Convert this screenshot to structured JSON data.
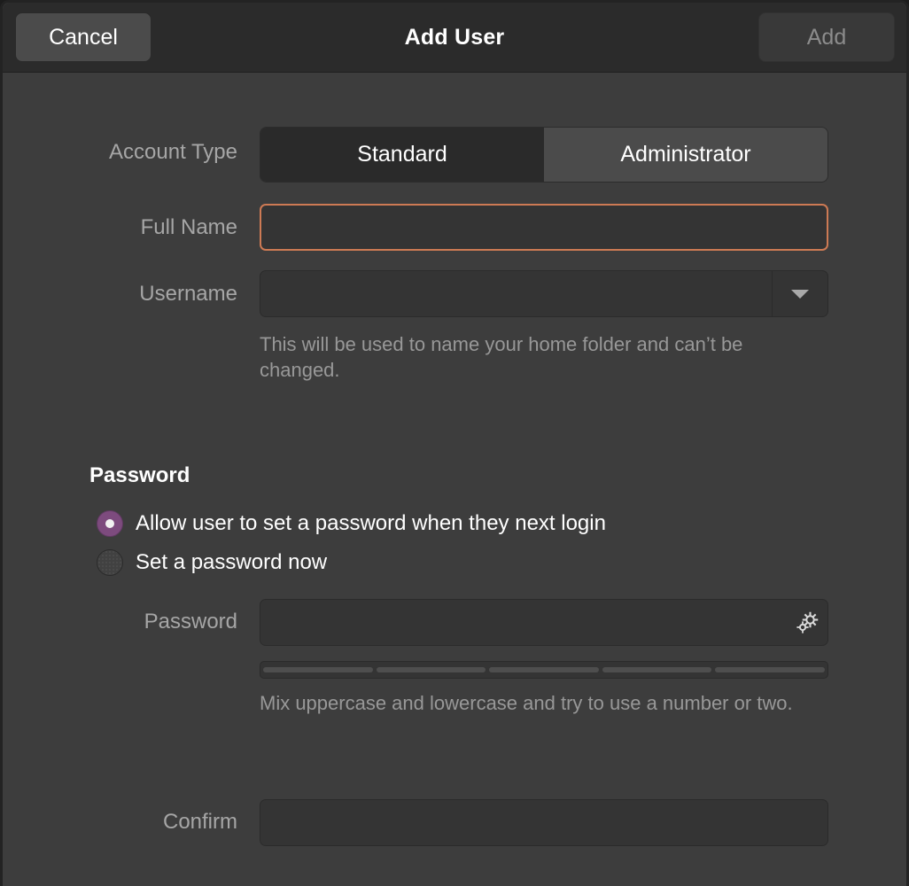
{
  "window": {
    "colors": {
      "header_bg": "#2b2b2b",
      "body_bg": "#3d3d3d",
      "focus_accent": "#cd7a54",
      "radio_selected": "#7d4b7e",
      "text_primary": "#ffffff",
      "text_muted": "#a6a6a6"
    }
  },
  "header": {
    "title": "Add User",
    "cancel_label": "Cancel",
    "add_label": "Add"
  },
  "form": {
    "account_type": {
      "label": "Account Type",
      "options": [
        "Standard",
        "Administrator"
      ],
      "selected": "Standard"
    },
    "full_name": {
      "label": "Full Name",
      "value": "",
      "placeholder": ""
    },
    "username": {
      "label": "Username",
      "value": "",
      "placeholder": "",
      "hint": "This will be used to name your home folder and can’t be changed.",
      "dropdown_icon": "chevron-down-icon"
    }
  },
  "password_section": {
    "title": "Password",
    "choices": [
      {
        "label": "Allow user to set a password when they next login",
        "selected": true
      },
      {
        "label": "Set a password now",
        "selected": false
      }
    ],
    "password_field": {
      "label": "Password",
      "value": "",
      "placeholder": "",
      "generate_icon": "gears-icon"
    },
    "strength": {
      "segments": 5,
      "filled": 0
    },
    "hint": "Mix uppercase and lowercase and try to use a number or two.",
    "confirm_field": {
      "label": "Confirm",
      "value": "",
      "placeholder": ""
    }
  }
}
